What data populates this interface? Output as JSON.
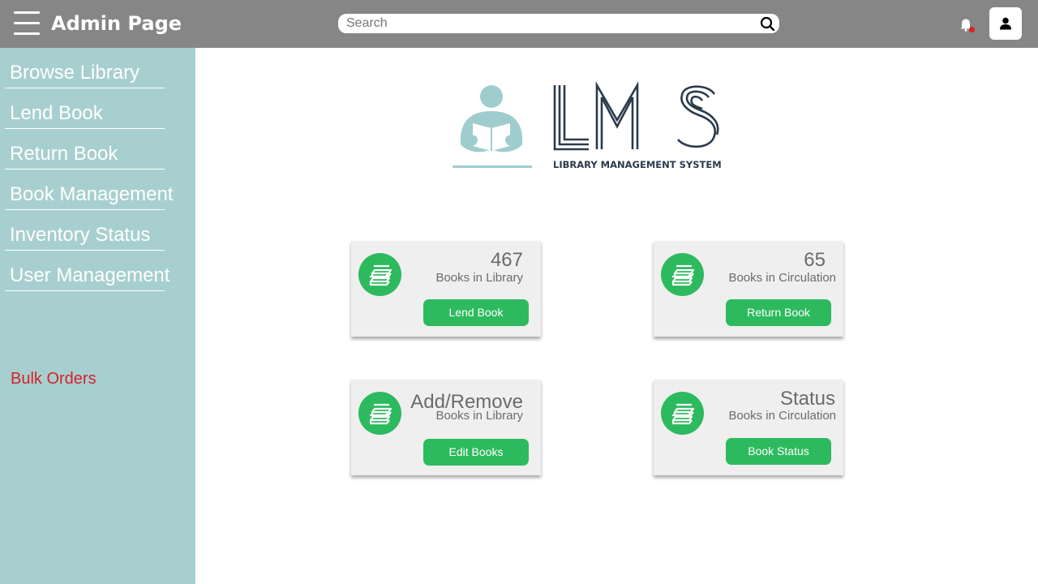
{
  "header": {
    "title": "Admin Page",
    "search_placeholder": "Search"
  },
  "sidebar": {
    "items": [
      {
        "label": "Browse Library"
      },
      {
        "label": "Lend Book"
      },
      {
        "label": "Return Book"
      },
      {
        "label": "Book Management"
      },
      {
        "label": "Inventory Status"
      },
      {
        "label": "User Management"
      }
    ],
    "bulk_orders": "Bulk Orders"
  },
  "logo": {
    "name": "LMS",
    "tagline": "LIBRARY MANAGEMENT SYSTEM"
  },
  "cards": [
    {
      "title": "467",
      "subtitle": "Books in Library",
      "button": "Lend Book"
    },
    {
      "title": "65",
      "subtitle": "Books in Circulation",
      "button": "Return Book"
    },
    {
      "title": "Add/Remove",
      "subtitle": "Books in Library",
      "button": "Edit Books"
    },
    {
      "title": "Status",
      "subtitle": "Books in Circulation",
      "button": "Book Status"
    }
  ],
  "colors": {
    "topbar": "#868686",
    "sidebar": "#a8cfcf",
    "accent_green": "#2dba5e",
    "bulk_orders_red": "#d2232a",
    "notification_dot": "#e0201b",
    "logo_dark": "#2a3b4c"
  },
  "icons": [
    "menu-icon",
    "search-icon",
    "bell-icon",
    "user-icon",
    "books-icon"
  ]
}
